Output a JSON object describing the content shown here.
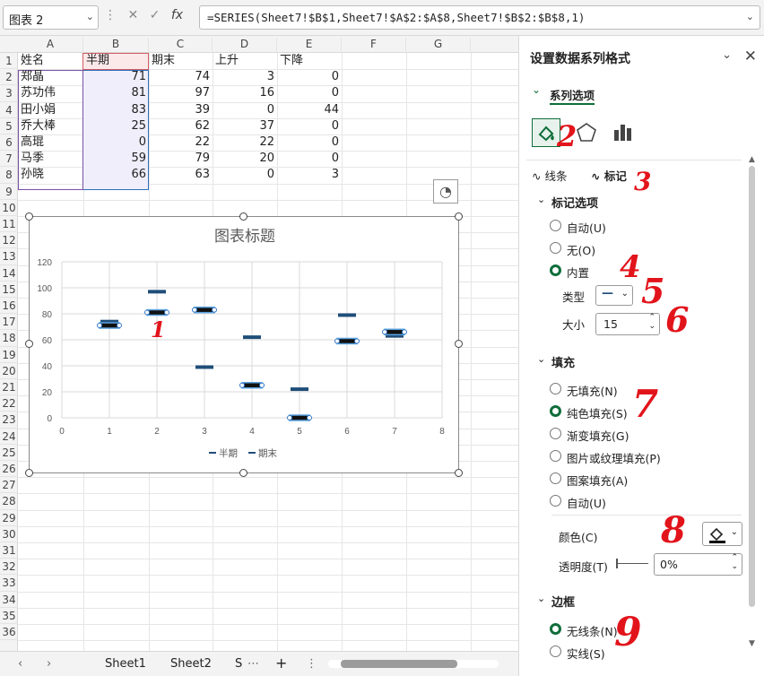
{
  "toolbar": {
    "name_box": "图表 2",
    "formula": "=SERIES(Sheet7!$B$1,Sheet7!$A$2:$A$8,Sheet7!$B$2:$B$8,1)"
  },
  "sheet": {
    "columns": [
      "A",
      "B",
      "C",
      "D",
      "E",
      "F",
      "G"
    ],
    "row_numbers": [
      "1",
      "2",
      "3",
      "4",
      "5",
      "6",
      "7",
      "8",
      "9",
      "10",
      "11",
      "12",
      "13",
      "14",
      "15",
      "16",
      "17",
      "18",
      "19",
      "20",
      "21",
      "22",
      "23",
      "24",
      "25",
      "26",
      "27",
      "28",
      "29",
      "30",
      "31",
      "32",
      "33",
      "34",
      "35",
      "36"
    ],
    "headers": [
      "姓名",
      "半期",
      "期末",
      "上升",
      "下降"
    ],
    "rows": [
      [
        "郑晶",
        "71",
        "74",
        "3",
        "0"
      ],
      [
        "苏功伟",
        "81",
        "97",
        "16",
        "0"
      ],
      [
        "田小娟",
        "83",
        "39",
        "0",
        "44"
      ],
      [
        "乔大棒",
        "25",
        "62",
        "37",
        "0"
      ],
      [
        "高琨",
        "0",
        "22",
        "22",
        "0"
      ],
      [
        "马季",
        "59",
        "79",
        "20",
        "0"
      ],
      [
        "孙晓",
        "66",
        "63",
        "0",
        "3"
      ]
    ],
    "tabs": [
      "Sheet1",
      "Sheet2",
      "S"
    ]
  },
  "chart_data": {
    "type": "scatter",
    "title": "图表标题",
    "x": [
      1,
      2,
      3,
      4,
      5,
      6,
      7
    ],
    "series": [
      {
        "name": "半期",
        "values": [
          71,
          81,
          83,
          25,
          0,
          59,
          66
        ]
      },
      {
        "name": "期末",
        "values": [
          74,
          97,
          39,
          62,
          22,
          79,
          63
        ]
      }
    ],
    "xticks": [
      "0",
      "1",
      "2",
      "3",
      "4",
      "5",
      "6",
      "7",
      "8"
    ],
    "yticks": [
      "0",
      "20",
      "40",
      "60",
      "80",
      "100",
      "120"
    ],
    "xlim": [
      0,
      8
    ],
    "ylim": [
      0,
      120
    ],
    "grid": true,
    "legend": "bottom",
    "legend_items": [
      "半期",
      "期末"
    ],
    "color": "#1f4e79"
  },
  "panel": {
    "title": "设置数据系列格式",
    "series_options": "系列选项",
    "tab_line": "线条",
    "tab_marker": "标记",
    "marker_options": "标记选项",
    "marker_choices": [
      "自动(U)",
      "无(O)",
      "内置"
    ],
    "type_label": "类型",
    "type_value": "—",
    "size_label": "大小",
    "size_value": "15",
    "fill_header": "填充",
    "fill_choices": [
      "无填充(N)",
      "纯色填充(S)",
      "渐变填充(G)",
      "图片或纹理填充(P)",
      "图案填充(A)",
      "自动(U)"
    ],
    "color_label": "颜色(C)",
    "transparency_label": "透明度(T)",
    "transparency_value": "0%",
    "border_header": "边框",
    "border_choices": [
      "无线条(N)",
      "实线(S)"
    ]
  },
  "annotations": [
    "1",
    "2",
    "3",
    "4",
    "5",
    "6",
    "7",
    "8",
    "9"
  ],
  "colors": {
    "marker": "#1f4e79",
    "selected_radio": "#0f6e3a",
    "annotation": "#e2141b",
    "highlight_b": "#efeefa"
  }
}
